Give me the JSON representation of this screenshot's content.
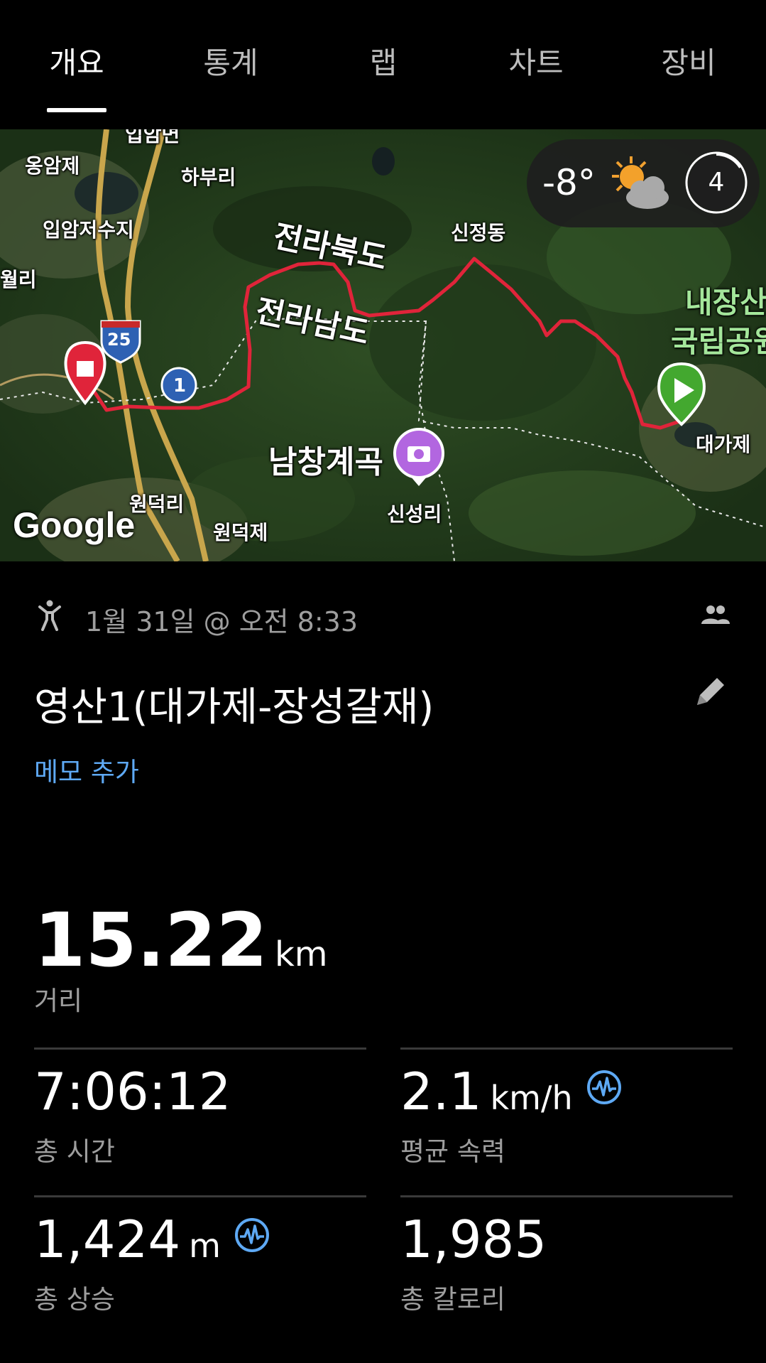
{
  "tabs": [
    {
      "label": "개요",
      "active": true
    },
    {
      "label": "통계",
      "active": false
    },
    {
      "label": "랩",
      "active": false
    },
    {
      "label": "차트",
      "active": false
    },
    {
      "label": "장비",
      "active": false
    }
  ],
  "map": {
    "labels": {
      "okamje": "옹암제",
      "ipamjeosuji": "입암저수지",
      "woldi": "월리",
      "habuli": "하부리",
      "jeonbuk": "전라북도",
      "jeonnam": "전라남도",
      "sinjeongdong": "신정동",
      "naejangsan1": "내장산",
      "naejangsan2": "국립공원",
      "dagaje": "대가제",
      "namchang": "남창계곡",
      "sinseongri": "신성리",
      "wondeokri": "원덕리",
      "wondeokje": "원덕제",
      "top_cut": "입암면"
    },
    "road_shields": {
      "highway": "25",
      "national": "1"
    },
    "google_logo": "Google",
    "weather": {
      "temperature": "-8°",
      "icon": "partly-cloudy-sun-icon",
      "uv_level": "4"
    },
    "route_color": "#e0243a"
  },
  "activity": {
    "type_icon": "hiking-person-icon",
    "datetime": "1월 31일 @ 오전 8:33",
    "title": "영산1(대가제-장성갈재)",
    "memo_link": "메모 추가",
    "distance": {
      "value": "15.22",
      "unit": "km",
      "label": "거리"
    },
    "stats": [
      {
        "value": "7:06:12",
        "unit": "",
        "label": "총 시간",
        "hr_icon": false
      },
      {
        "value": "2.1",
        "unit": "km/h",
        "label": "평균 속력",
        "hr_icon": true
      },
      {
        "value": "1,424",
        "unit": "m",
        "label": "총 상승",
        "hr_icon": true
      },
      {
        "value": "1,985",
        "unit": "",
        "label": "총 칼로리",
        "hr_icon": false
      }
    ]
  },
  "colors": {
    "accent": "#5ea9f4",
    "background": "#000000",
    "secondary_text": "#9e9e9e"
  }
}
